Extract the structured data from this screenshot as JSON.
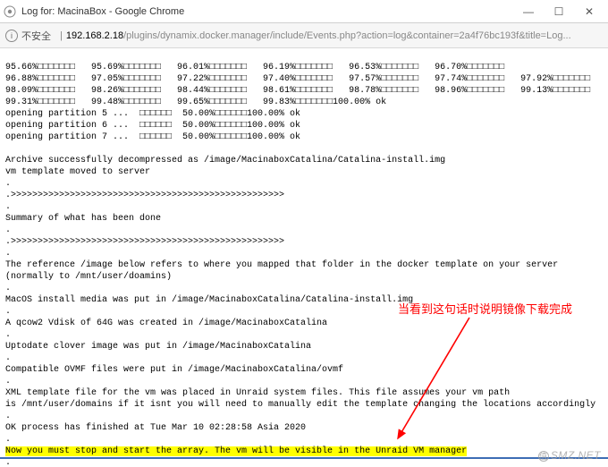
{
  "window": {
    "title": "Log for: MacinaBox - Google Chrome",
    "min": "—",
    "max": "☐",
    "close": "✕"
  },
  "address": {
    "insecure_label": "不安全",
    "host": "192.168.2.18",
    "path": "/plugins/dynamix.docker.manager/include/Events.php?action=log&container=2a4f76bc193f&title=Log..."
  },
  "log": {
    "l01": "95.66%□□□□□□□   95.69%□□□□□□□   96.01%□□□□□□□   96.19%□□□□□□□   96.53%□□□□□□□   96.70%□□□□□□□",
    "l02": "96.88%□□□□□□□   97.05%□□□□□□□   97.22%□□□□□□□   97.40%□□□□□□□   97.57%□□□□□□□   97.74%□□□□□□□   97.92%□□□□□□□",
    "l03": "98.09%□□□□□□□   98.26%□□□□□□□   98.44%□□□□□□□   98.61%□□□□□□□   98.78%□□□□□□□   98.96%□□□□□□□   99.13%□□□□□□□",
    "l04": "99.31%□□□□□□□   99.48%□□□□□□□   99.65%□□□□□□□   99.83%□□□□□□□100.00% ok",
    "l05": "opening partition 5 ...  □□□□□□  50.00%□□□□□□100.00% ok",
    "l06": "opening partition 6 ...  □□□□□□  50.00%□□□□□□100.00% ok",
    "l07": "opening partition 7 ...  □□□□□□  50.00%□□□□□□100.00% ok",
    "l08": "",
    "l09": "Archive successfully decompressed as /image/MacinaboxCatalina/Catalina-install.img",
    "l10": "vm template moved to server",
    "l11": ".",
    "l12": ".>>>>>>>>>>>>>>>>>>>>>>>>>>>>>>>>>>>>>>>>>>>>>>>>>>>",
    "l13": ".",
    "l14": "Summary of what has been done",
    "l15": ".",
    "l16": ".>>>>>>>>>>>>>>>>>>>>>>>>>>>>>>>>>>>>>>>>>>>>>>>>>>>",
    "l17": ".",
    "l18": "The reference /image below refers to where you mapped that folder in the docker template on your server",
    "l19": "(normally to /mnt/user/doamins)",
    "l20": ".",
    "l21": "MacOS install media was put in /image/MacinaboxCatalina/Catalina-install.img",
    "l22": ".",
    "l23": "A qcow2 Vdisk of 64G was created in /image/MacinaboxCatalina",
    "l24": ".",
    "l25": "Uptodate clover image was put in /image/MacinaboxCatalina",
    "l26": ".",
    "l27": "Compatible OVMF files were put in /image/MacinaboxCatalina/ovmf",
    "l28": ".",
    "l29": "XML template file for the vm was placed in Unraid system files. This file assumes your vm path",
    "l30": "is /mnt/user/domains if it isnt you will need to manually edit the template changing the locations accordingly",
    "l31": ".",
    "l32": "OK process has finished at Tue Mar 10 02:28:58 Asia 2020",
    "l33": ".",
    "l34": "Now you must stop and start the array. The vm will be visible in the Unraid VM manager",
    "l35": "."
  },
  "annotation": {
    "text": "当看到这句话时说明镜像下载完成"
  },
  "watermark": {
    "text": "SMZ.NET"
  }
}
